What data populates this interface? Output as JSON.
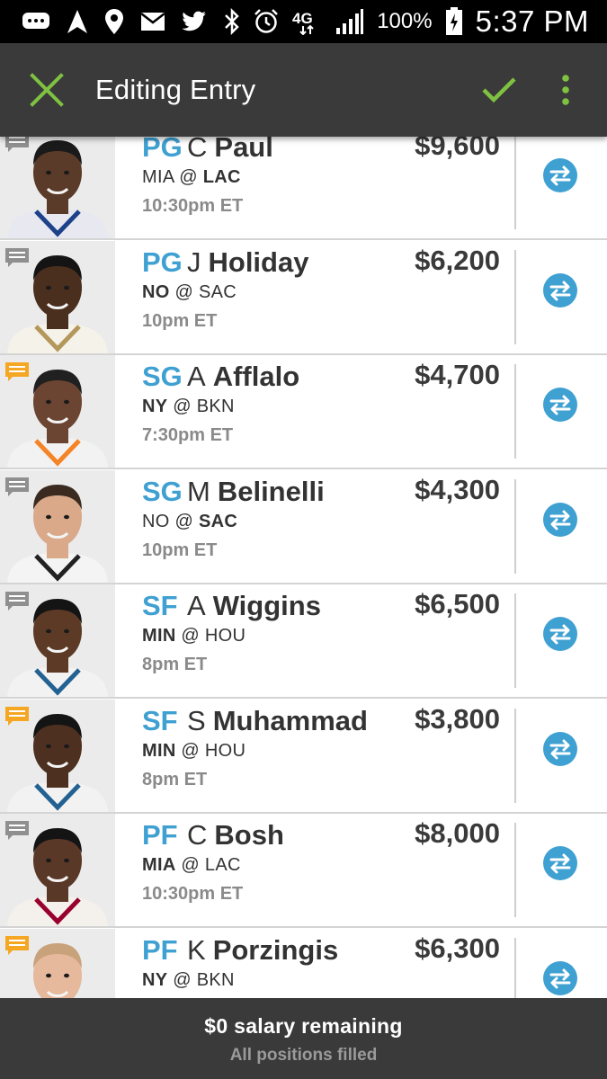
{
  "status_bar": {
    "battery": "100%",
    "time": "5:37 PM",
    "network": "4G",
    "icons": [
      "chat-icon",
      "navigation-icon",
      "location-icon",
      "mail-icon",
      "twitter-icon",
      "bluetooth-icon",
      "alarm-icon",
      "signal-icon",
      "battery-icon"
    ]
  },
  "header": {
    "title": "Editing Entry",
    "close_icon": "close-icon",
    "confirm_icon": "check-icon",
    "menu_icon": "more-vert-icon"
  },
  "colors": {
    "accent_green": "#7fc241",
    "position_blue": "#3fa0d2",
    "swap_blue": "#3fa0d2",
    "note_gray": "#8f8f8f",
    "note_orange": "#f5a623",
    "bar_dark": "#3a3a3a"
  },
  "players": [
    {
      "position": "PG",
      "first": "C",
      "last": "Paul",
      "salary": "$9,600",
      "away": "MIA",
      "home": "LAC",
      "bold": "home",
      "time": "10:30pm ET",
      "note": "gray",
      "jersey": "#e8e8f0",
      "trim": "#1d428a",
      "skin": "#5a3a28",
      "hair": "#1a1a1a"
    },
    {
      "position": "PG",
      "first": "J",
      "last": "Holiday",
      "salary": "$6,200",
      "away": "NO",
      "home": "SAC",
      "bold": "away",
      "time": "10pm ET",
      "note": "gray",
      "jersey": "#f5f2ea",
      "trim": "#b4975a",
      "skin": "#4a2e1e",
      "hair": "#141414"
    },
    {
      "position": "SG",
      "first": "A",
      "last": "Afflalo",
      "salary": "$4,700",
      "away": "NY",
      "home": "BKN",
      "bold": "away",
      "time": "7:30pm ET",
      "note": "orange",
      "jersey": "#f2f2f2",
      "trim": "#f58426",
      "skin": "#6b4532",
      "hair": "#202020"
    },
    {
      "position": "SG",
      "first": "M",
      "last": "Belinelli",
      "salary": "$4,300",
      "away": "NO",
      "home": "SAC",
      "bold": "home",
      "time": "10pm ET",
      "note": "gray",
      "jersey": "#f4f4f4",
      "trim": "#222222",
      "skin": "#d9a98a",
      "hair": "#3a2a20"
    },
    {
      "position": "SF",
      "first": "A",
      "last": "Wiggins",
      "salary": "$6,500",
      "away": "MIN",
      "home": "HOU",
      "bold": "away",
      "time": "8pm ET",
      "note": "gray",
      "jersey": "#f2f2f2",
      "trim": "#236192",
      "skin": "#5c3a26",
      "hair": "#141414"
    },
    {
      "position": "SF",
      "first": "S",
      "last": "Muhammad",
      "salary": "$3,800",
      "away": "MIN",
      "home": "HOU",
      "bold": "away",
      "time": "8pm ET",
      "note": "orange",
      "jersey": "#f2f2f2",
      "trim": "#236192",
      "skin": "#4e3020",
      "hair": "#141414"
    },
    {
      "position": "PF",
      "first": "C",
      "last": "Bosh",
      "salary": "$8,000",
      "away": "MIA",
      "home": "LAC",
      "bold": "away",
      "time": "10:30pm ET",
      "note": "gray",
      "jersey": "#f4f0ec",
      "trim": "#98002e",
      "skin": "#5a3828",
      "hair": "#141414"
    },
    {
      "position": "PF",
      "first": "K",
      "last": "Porzingis",
      "salary": "$6,300",
      "away": "NY",
      "home": "BKN",
      "bold": "away",
      "time": "",
      "note": "orange",
      "jersey": "#f2f2f2",
      "trim": "#f58426",
      "skin": "#e6b89c",
      "hair": "#c8a27a"
    }
  ],
  "footer": {
    "remaining": "$0 salary remaining",
    "status": "All positions filled"
  }
}
